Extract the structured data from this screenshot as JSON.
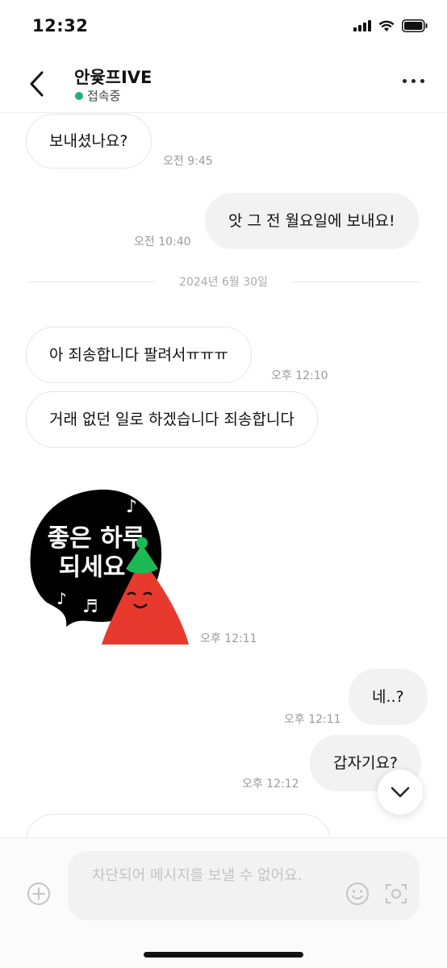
{
  "status_bar": {
    "time": "12:32"
  },
  "header": {
    "title": "안윷프IVE",
    "presence": "접속중"
  },
  "messages": [
    {
      "direction": "in",
      "text": "보내셨나요?",
      "time": "오전 9:45"
    },
    {
      "direction": "out",
      "text": "앗 그 전 월요일에 보내요!",
      "time": "오전 10:40"
    },
    {
      "type": "date",
      "text": "2024년 6월 30일"
    },
    {
      "direction": "in",
      "text": "아 죄송합니다 팔려서ㅠㅠㅠ",
      "time": "오후 12:10"
    },
    {
      "direction": "in",
      "text": "거래 없던 일로 하겠습니다 죄송합니다"
    },
    {
      "direction": "in",
      "type": "sticker",
      "sticker_text_line1": "좋은 하루",
      "sticker_text_line2": "되세요",
      "time": "오후 12:11"
    },
    {
      "direction": "out",
      "text": "네..?",
      "time": "오후 12:11"
    },
    {
      "direction": "out",
      "text": "갑자기요?",
      "time": "오후 12:12"
    }
  ],
  "input": {
    "placeholder": "차단되어 메시지를 보낼 수 없어요."
  },
  "icons": {
    "back": "chevron-left-icon",
    "more": "more-horizontal-icon",
    "scroll_down": "chevron-down-icon",
    "plus": "plus-circle-icon",
    "emoji": "smile-icon",
    "camera": "camera-scan-icon"
  },
  "colors": {
    "presence": "#22b07a",
    "sticker_bg": "#000000",
    "sticker_character": "#e8392e",
    "sticker_hat": "#1db954"
  }
}
